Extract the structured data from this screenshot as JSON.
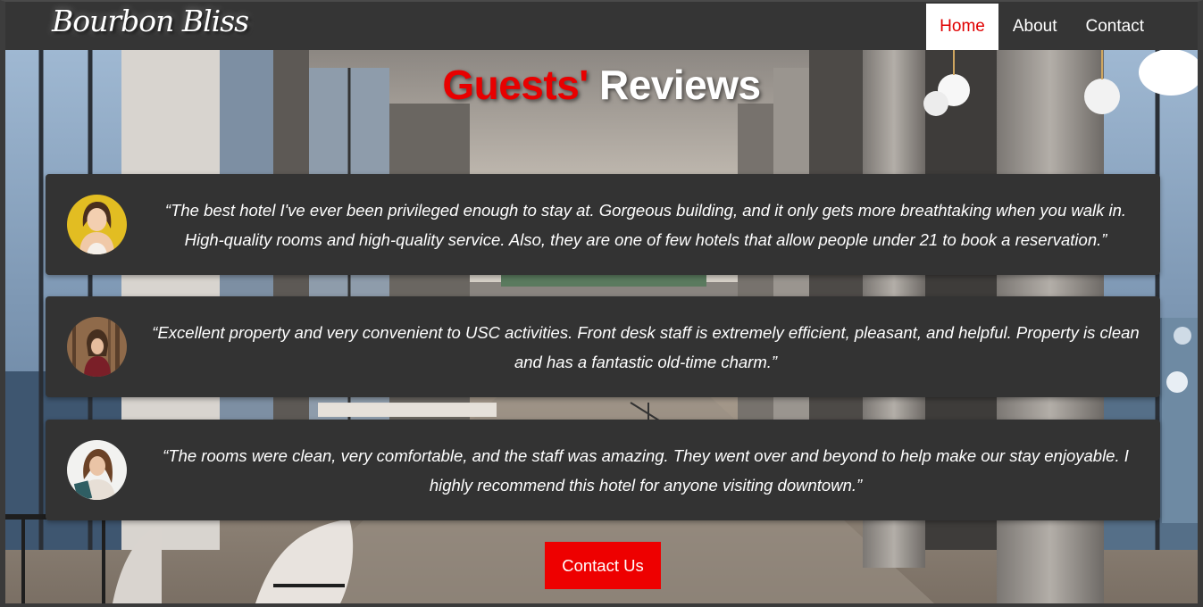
{
  "brand": {
    "name": "Bourbon Bliss"
  },
  "nav": {
    "items": [
      {
        "label": "Home",
        "active": true
      },
      {
        "label": "About",
        "active": false
      },
      {
        "label": "Contact",
        "active": false
      }
    ]
  },
  "heading": {
    "accent": "Guests'",
    "main": "Reviews"
  },
  "reviews": [
    {
      "avatar": "woman-portrait-yellow-background",
      "text": "“The best hotel I've ever been privileged enough to stay at. Gorgeous building, and it only gets more breathtaking when you walk in. High-quality rooms and high-quality service. Also, they are one of few hotels that allow people under 21 to book a reservation.”"
    },
    {
      "avatar": "woman-in-forest",
      "text": "“Excellent property and very convenient to USC activities. Front desk staff is extremely efficient, pleasant, and helpful. Property is clean and has a fantastic old-time charm.”"
    },
    {
      "avatar": "woman-holding-book",
      "text": "“The rooms were clean, very comfortable, and the staff was amazing. They went over and beyond to help make our stay enjoyable. I highly recommend this hotel for anyone visiting downtown.”"
    }
  ],
  "cta": {
    "label": "Contact Us"
  },
  "colors": {
    "accent": "#e80000",
    "navbar": "#353535",
    "card": "#333333",
    "button": "#ee0000"
  }
}
